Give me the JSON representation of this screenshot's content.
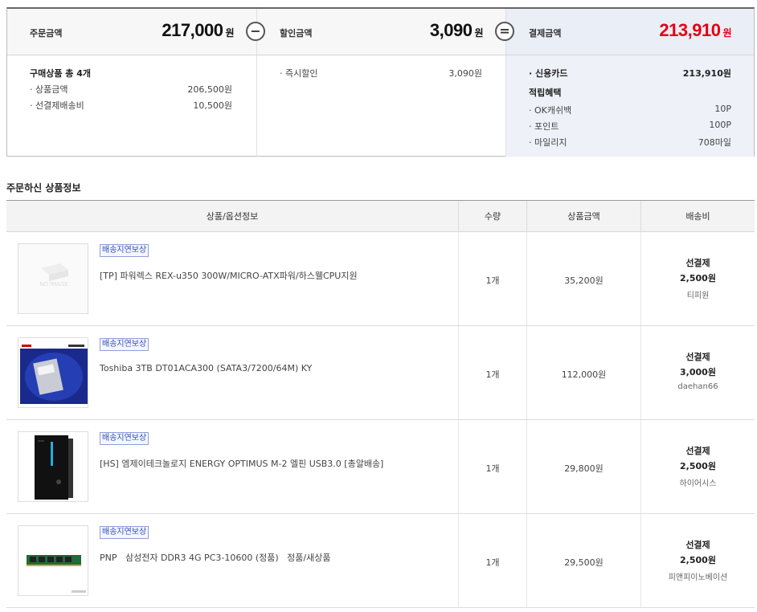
{
  "summary": {
    "order": {
      "label": "주문금액",
      "amount": "217,000",
      "unit": "원"
    },
    "discount": {
      "label": "할인금액",
      "amount": "3,090",
      "unit": "원"
    },
    "payment": {
      "label": "결제금액",
      "amount": "213,910",
      "unit": "원"
    },
    "minus_sign": "−",
    "equal_sign": "=",
    "order_detail": {
      "title": "구매상품 총 4개",
      "items": [
        {
          "label": "· 상품금액",
          "value": "206,500원"
        },
        {
          "label": "· 선결제배송비",
          "value": "10,500원"
        }
      ]
    },
    "discount_detail": {
      "items": [
        {
          "label": "· 즉시할인",
          "value": "3,090원"
        }
      ]
    },
    "payment_detail": {
      "card": {
        "label": "· 신용카드",
        "value": "213,910원"
      },
      "reward_title": "적립혜택",
      "rewards": [
        {
          "label": "· OK캐쉬백",
          "value": "10P"
        },
        {
          "label": "· 포인트",
          "value": "100P"
        },
        {
          "label": "· 마일리지",
          "value": "708마일"
        }
      ]
    }
  },
  "section_title": "주문하신 상품정보",
  "table": {
    "headers": {
      "product": "상품/옵션정보",
      "qty": "수량",
      "price": "상품금액",
      "shipping": "배송비"
    },
    "rows": [
      {
        "badge": "배송지연보상",
        "name": "[TP] 파워렉스 REX-u350 300W/MICRO-ATX파워/하스웰CPU지원",
        "qty": "1개",
        "price": "35,200원",
        "ship_type": "선결제",
        "ship_fee": "2,500원",
        "seller": "티피원",
        "thumb": "no-image"
      },
      {
        "badge": "배송지연보상",
        "name": "Toshiba 3TB DT01ACA300 (SATA3/7200/64M) KY",
        "qty": "1개",
        "price": "112,000원",
        "ship_type": "선결제",
        "ship_fee": "3,000원",
        "seller": "daehan66",
        "thumb": "hdd"
      },
      {
        "badge": "배송지연보상",
        "name": "[HS] 엠제이테크놀로지 ENERGY OPTIMUS M-2 엘핀 USB3.0 [총알배송]",
        "qty": "1개",
        "price": "29,800원",
        "ship_type": "선결제",
        "ship_fee": "2,500원",
        "seller": "하이어시스",
        "thumb": "case"
      },
      {
        "badge": "배송지연보상",
        "name": "PNP   삼성전자 DDR3 4G PC3-10600 (정품)   정품/새상품",
        "qty": "1개",
        "price": "29,500원",
        "ship_type": "선결제",
        "ship_fee": "2,500원",
        "seller": "피앤피이노베이션",
        "thumb": "ram"
      }
    ]
  },
  "colors": {
    "accent_red": "#e60012",
    "badge_blue": "#3451b2",
    "pay_bg": "#eef1f8"
  }
}
